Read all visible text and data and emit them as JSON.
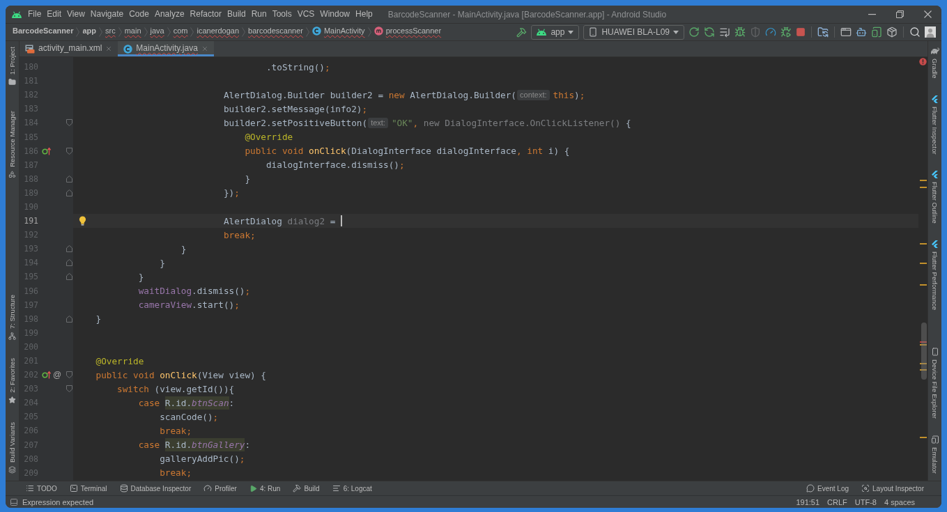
{
  "window": {
    "title": "BarcodeScanner - MainActivity.java [BarcodeScanner.app] - Android Studio"
  },
  "menu": [
    "File",
    "Edit",
    "View",
    "Navigate",
    "Code",
    "Analyze",
    "Refactor",
    "Build",
    "Run",
    "Tools",
    "VCS",
    "Window",
    "Help"
  ],
  "breadcrumb": [
    {
      "label": "BarcodeScanner",
      "kind": "project",
      "error": false
    },
    {
      "label": "app",
      "kind": "module",
      "error": false
    },
    {
      "label": "src",
      "kind": "folder",
      "error": true
    },
    {
      "label": "main",
      "kind": "folder",
      "error": true
    },
    {
      "label": "java",
      "kind": "folder",
      "error": true
    },
    {
      "label": "com",
      "kind": "folder",
      "error": true
    },
    {
      "label": "icanerdogan",
      "kind": "folder",
      "error": true
    },
    {
      "label": "barcodescanner",
      "kind": "folder",
      "error": true
    },
    {
      "label": "MainActivity",
      "kind": "class",
      "error": true
    },
    {
      "label": "processScanner",
      "kind": "method",
      "error": true
    }
  ],
  "toolbar": {
    "run_config": "app",
    "device": "HUAWEI BLA-L09"
  },
  "editor_tabs": [
    {
      "label": "activity_main.xml",
      "kind": "layout",
      "selected": false,
      "error": false
    },
    {
      "label": "MainActivity.java",
      "kind": "class",
      "selected": true,
      "error": true
    }
  ],
  "left_tool_windows": {
    "top": [
      {
        "label": "1: Project",
        "kind": "project"
      },
      {
        "label": "Resource Manager",
        "kind": "resources"
      }
    ],
    "bottom": [
      {
        "label": "7: Structure",
        "kind": "structure"
      },
      {
        "label": "2: Favorites",
        "kind": "favorites"
      },
      {
        "label": "Build Variants",
        "kind": "variants"
      }
    ]
  },
  "right_tool_windows": {
    "top": [
      {
        "label": "Gradle",
        "kind": "gradle"
      },
      {
        "label": "Flutter Inspector",
        "kind": "flutter"
      },
      {
        "label": "Flutter Outline",
        "kind": "flutter"
      },
      {
        "label": "Flutter Performance",
        "kind": "flutter"
      }
    ],
    "bottom": [
      {
        "label": "Device File Explorer",
        "kind": "device"
      },
      {
        "label": "Emulator",
        "kind": "emulator"
      }
    ]
  },
  "editor": {
    "lines": [
      {
        "number": "180",
        "current": false,
        "tokens": [
          {
            "kind": "plain",
            "text": "                                    .toString()"
          },
          {
            "kind": "keyword",
            "text": ";"
          }
        ]
      },
      {
        "number": "181",
        "current": false
      },
      {
        "number": "182",
        "current": false,
        "tokens": [
          {
            "kind": "plain",
            "text": "                            AlertDialog.Builder builder2 = "
          },
          {
            "kind": "keyword",
            "text": "new"
          },
          {
            "kind": "plain",
            "text": " AlertDialog.Builder("
          },
          {
            "kind": "hint",
            "text": "context:"
          },
          {
            "kind": "keyword",
            "text": "this"
          },
          {
            "kind": "plain",
            "text": ")"
          },
          {
            "kind": "keyword",
            "text": ";"
          }
        ]
      },
      {
        "number": "183",
        "current": false,
        "tokens": [
          {
            "kind": "plain",
            "text": "                            builder2.setMessage(info2)"
          },
          {
            "kind": "keyword",
            "text": ";"
          }
        ]
      },
      {
        "number": "184",
        "current": false,
        "markers": [
          {
            "kind": "fold_start"
          }
        ],
        "tokens": [
          {
            "kind": "plain",
            "text": "                            builder2.setPositiveButton("
          },
          {
            "kind": "hint",
            "text": "text:"
          },
          {
            "kind": "string",
            "text": "\"OK\""
          },
          {
            "kind": "keyword",
            "text": ","
          },
          {
            "kind": "greyed",
            "text": " new DialogInterface.OnClickListener()"
          },
          {
            "kind": "plain",
            "text": " {"
          }
        ]
      },
      {
        "number": "185",
        "current": false,
        "tokens": [
          {
            "kind": "annotation",
            "text": "                                @Override"
          }
        ]
      },
      {
        "number": "186",
        "current": false,
        "markers": [
          {
            "kind": "override"
          },
          {
            "kind": "fold_start"
          }
        ],
        "tokens": [
          {
            "kind": "keyword",
            "text": "                                public void "
          },
          {
            "kind": "method",
            "text": "onClick"
          },
          {
            "kind": "plain",
            "text": "(DialogInterface dialogInterface"
          },
          {
            "kind": "keyword",
            "text": ", int"
          },
          {
            "kind": "plain",
            "text": " i) {"
          }
        ]
      },
      {
        "number": "187",
        "current": false,
        "tokens": [
          {
            "kind": "plain",
            "text": "                                    dialogInterface.dismiss()"
          },
          {
            "kind": "keyword",
            "text": ";"
          }
        ]
      },
      {
        "number": "188",
        "current": false,
        "markers": [
          {
            "kind": "fold_end"
          }
        ],
        "tokens": [
          {
            "kind": "plain",
            "text": "                                }"
          }
        ]
      },
      {
        "number": "189",
        "current": false,
        "markers": [
          {
            "kind": "fold_end"
          }
        ],
        "tokens": [
          {
            "kind": "plain",
            "text": "                            })"
          },
          {
            "kind": "keyword",
            "text": ";"
          }
        ]
      },
      {
        "number": "190",
        "current": false
      },
      {
        "number": "191",
        "current": true,
        "markers": [
          {
            "kind": "intention"
          }
        ],
        "tokens": [
          {
            "kind": "plain",
            "text": "                            AlertDialog "
          },
          {
            "kind": "unused",
            "text": "dialog2"
          },
          {
            "kind": "plain",
            "text": " = "
          }
        ]
      },
      {
        "number": "192",
        "current": false,
        "tokens": [
          {
            "kind": "keyword",
            "text": "                            break;"
          }
        ]
      },
      {
        "number": "193",
        "current": false,
        "markers": [
          {
            "kind": "fold_end"
          }
        ],
        "tokens": [
          {
            "kind": "plain",
            "text": "                    }"
          }
        ]
      },
      {
        "number": "194",
        "current": false,
        "markers": [
          {
            "kind": "fold_end"
          }
        ],
        "tokens": [
          {
            "kind": "plain",
            "text": "                }"
          }
        ]
      },
      {
        "number": "195",
        "current": false,
        "markers": [
          {
            "kind": "fold_end"
          }
        ],
        "tokens": [
          {
            "kind": "plain",
            "text": "            }"
          }
        ]
      },
      {
        "number": "196",
        "current": false,
        "tokens": [
          {
            "kind": "field",
            "text": "            waitDialog"
          },
          {
            "kind": "plain",
            "text": ".dismiss()"
          },
          {
            "kind": "keyword",
            "text": ";"
          }
        ]
      },
      {
        "number": "197",
        "current": false,
        "tokens": [
          {
            "kind": "field",
            "text": "            cameraView"
          },
          {
            "kind": "plain",
            "text": ".start()"
          },
          {
            "kind": "keyword",
            "text": ";"
          }
        ]
      },
      {
        "number": "198",
        "current": false,
        "markers": [
          {
            "kind": "fold_end"
          }
        ],
        "tokens": [
          {
            "kind": "plain",
            "text": "    }"
          }
        ]
      },
      {
        "number": "199",
        "current": false
      },
      {
        "number": "200",
        "current": false
      },
      {
        "number": "201",
        "current": false,
        "tokens": [
          {
            "kind": "annotation",
            "text": "    @Override"
          }
        ]
      },
      {
        "number": "202",
        "current": false,
        "markers": [
          {
            "kind": "override"
          },
          {
            "kind": "symbol",
            "text": "@"
          },
          {
            "kind": "fold_start"
          }
        ],
        "tokens": [
          {
            "kind": "keyword",
            "text": "    public void "
          },
          {
            "kind": "method",
            "text": "onClick"
          },
          {
            "kind": "plain",
            "text": "(View view) {"
          }
        ]
      },
      {
        "number": "203",
        "current": false,
        "markers": [
          {
            "kind": "fold_start"
          }
        ],
        "tokens": [
          {
            "kind": "keyword",
            "text": "        switch"
          },
          {
            "kind": "plain",
            "text": " (view.getId()){"
          }
        ]
      },
      {
        "number": "204",
        "current": false,
        "tokens": [
          {
            "kind": "keyword",
            "text": "            case "
          },
          {
            "kind": "ref",
            "text": "R.id."
          },
          {
            "kind": "static_ref",
            "text": "btnScan"
          },
          {
            "kind": "plain",
            "text": ":"
          }
        ]
      },
      {
        "number": "205",
        "current": false,
        "tokens": [
          {
            "kind": "plain",
            "text": "                scanCode()"
          },
          {
            "kind": "keyword",
            "text": ";"
          }
        ]
      },
      {
        "number": "206",
        "current": false,
        "tokens": [
          {
            "kind": "keyword",
            "text": "                break;"
          }
        ]
      },
      {
        "number": "207",
        "current": false,
        "tokens": [
          {
            "kind": "keyword",
            "text": "            case "
          },
          {
            "kind": "ref",
            "text": "R.id."
          },
          {
            "kind": "static_ref",
            "text": "btnGallery"
          },
          {
            "kind": "plain",
            "text": ":"
          }
        ]
      },
      {
        "number": "208",
        "current": false,
        "tokens": [
          {
            "kind": "plain",
            "text": "                galleryAddPic()"
          },
          {
            "kind": "keyword",
            "text": ";"
          }
        ]
      },
      {
        "number": "209",
        "current": false,
        "tokens": [
          {
            "kind": "keyword",
            "text": "                break;"
          }
        ]
      }
    ]
  },
  "bottom_tool_windows": {
    "left": [
      {
        "label": "TODO",
        "kind": "todo"
      },
      {
        "label": "Terminal",
        "kind": "terminal"
      },
      {
        "label": "Database Inspector",
        "kind": "database"
      },
      {
        "label": "Profiler",
        "kind": "profiler"
      },
      {
        "label": "4: Run",
        "kind": "run"
      },
      {
        "label": "Build",
        "kind": "build"
      },
      {
        "label": "6: Logcat",
        "kind": "logcat"
      }
    ],
    "right": [
      {
        "label": "Event Log",
        "kind": "events"
      },
      {
        "label": "Layout Inspector",
        "kind": "layout"
      }
    ]
  },
  "status_bar": {
    "message": "Expression expected",
    "position": "191:51",
    "line_separator": "CRLF",
    "encoding": "UTF-8",
    "indent": "4 spaces"
  }
}
